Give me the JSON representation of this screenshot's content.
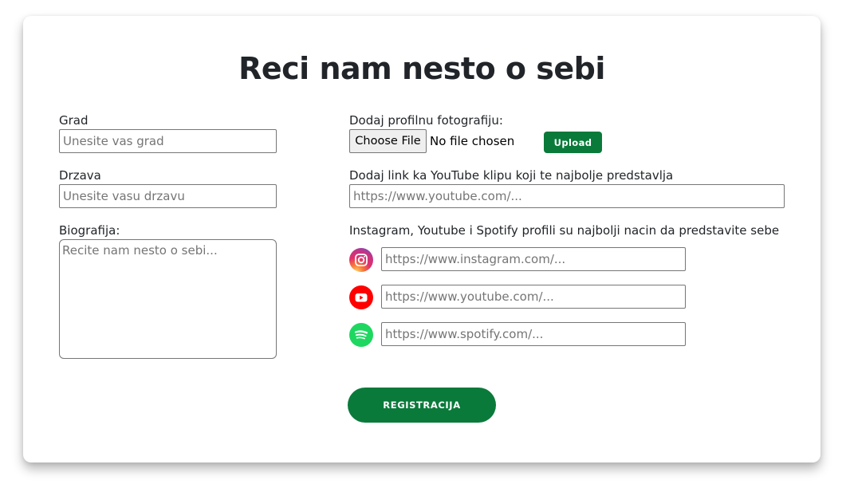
{
  "page": {
    "title": "Reci nam nesto o sebi"
  },
  "left": {
    "city": {
      "label": "Grad",
      "placeholder": "Unesite vas grad",
      "value": ""
    },
    "country": {
      "label": "Drzava",
      "placeholder": "Unesite vasu drzavu",
      "value": ""
    },
    "bio": {
      "label": "Biografija:",
      "placeholder": "Recite nam nesto o sebi...",
      "value": ""
    }
  },
  "right": {
    "photo": {
      "label": "Dodaj profilnu fotografiju:",
      "choose_label": "Choose File",
      "no_file_text": "No file chosen",
      "upload_label": "Upload"
    },
    "video": {
      "label": "Dodaj link ka YouTube klipu koji te najbolje predstavlja",
      "placeholder": "https://www.youtube.com/..."
    },
    "social": {
      "label": "Instagram, Youtube i Spotify profili su najbolji nacin da predstavite sebe",
      "instagram": {
        "icon": "instagram-icon",
        "placeholder": "https://www.instagram.com/..."
      },
      "youtube": {
        "icon": "youtube-icon",
        "placeholder": "https://www.youtube.com/..."
      },
      "spotify": {
        "icon": "spotify-icon",
        "placeholder": "https://www.spotify.com/..."
      }
    }
  },
  "submit": {
    "label": "REGISTRACIJA"
  },
  "colors": {
    "primary_green": "#0a7a3a",
    "youtube_red": "#ff0000",
    "spotify_green": "#1ed760"
  }
}
